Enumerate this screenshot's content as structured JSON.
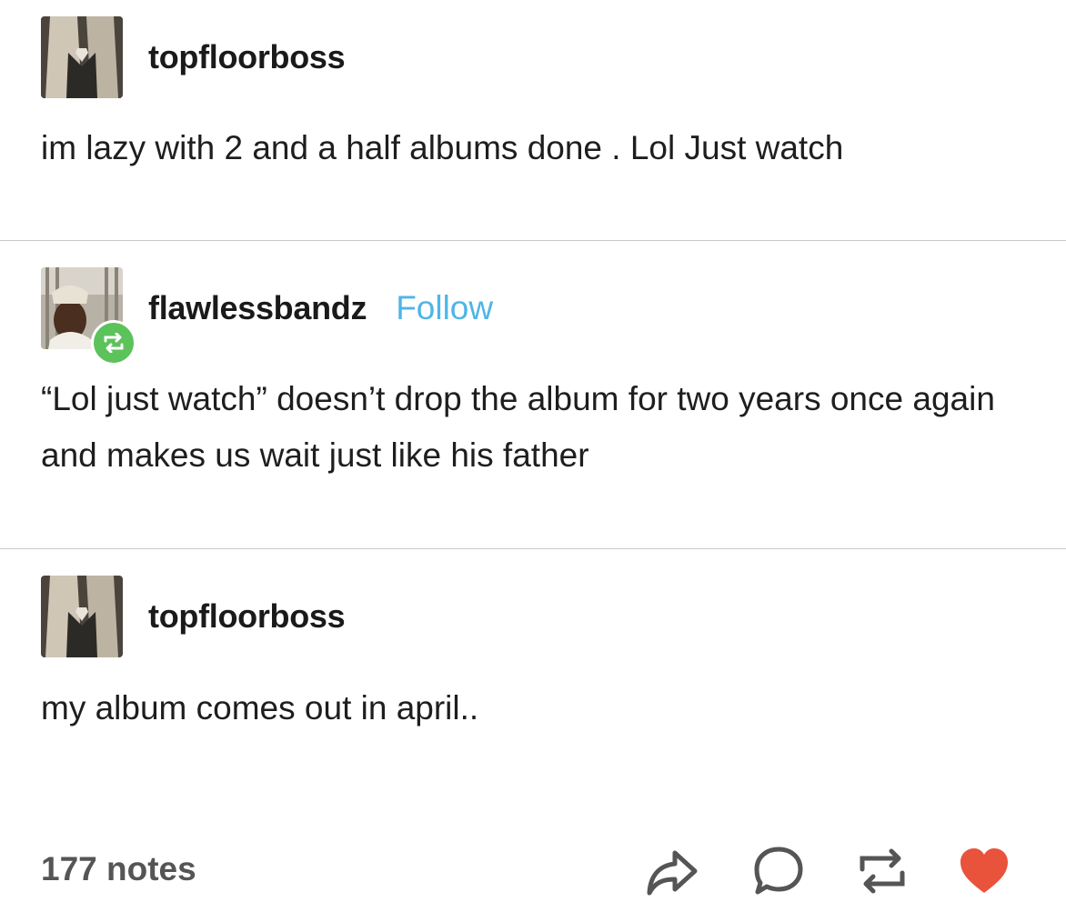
{
  "posts": [
    {
      "username": "topfloorboss",
      "text": "im lazy with 2 and a half albums done . Lol Just watch"
    },
    {
      "username": "flawlessbandz",
      "follow_label": "Follow",
      "text": "“Lol just watch” doesn’t drop the album for two years once again and makes us wait just like his father"
    },
    {
      "username": "topfloorboss",
      "text": "my album comes out in april.."
    }
  ],
  "footer": {
    "notes": "177 notes",
    "actions": [
      "share-icon",
      "comment-icon",
      "reblog-icon",
      "heart-icon"
    ]
  },
  "colors": {
    "follow_link": "#4fb5e6",
    "reblog_badge": "#5cc25a",
    "heart": "#e9533b",
    "icon": "#555555"
  }
}
